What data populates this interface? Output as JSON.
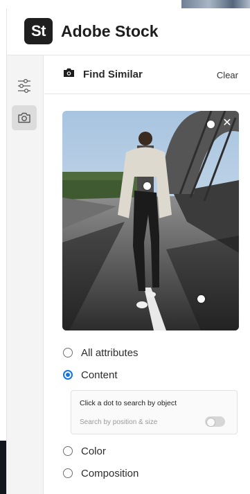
{
  "header": {
    "logo_text": "St",
    "brand": "Adobe Stock"
  },
  "sidebar": {
    "items": [
      {
        "name": "filters",
        "icon": "sliders-icon"
      },
      {
        "name": "find-similar",
        "icon": "camera-icon",
        "active": true
      }
    ]
  },
  "find_similar": {
    "title": "Find Similar",
    "clear_label": "Clear",
    "close_symbol": "✕",
    "image_description_icon": "camera-icon"
  },
  "options": [
    {
      "label": "All attributes",
      "checked": false
    },
    {
      "label": "Content",
      "checked": true
    },
    {
      "label": "Color",
      "checked": false
    },
    {
      "label": "Composition",
      "checked": false
    }
  ],
  "content_panel": {
    "instruction": "Click a dot to search by object",
    "toggle_label": "Search by position & size",
    "toggle_on": false
  },
  "colors": {
    "accent": "#1473e6",
    "logo_bg": "#1f1f1f"
  }
}
